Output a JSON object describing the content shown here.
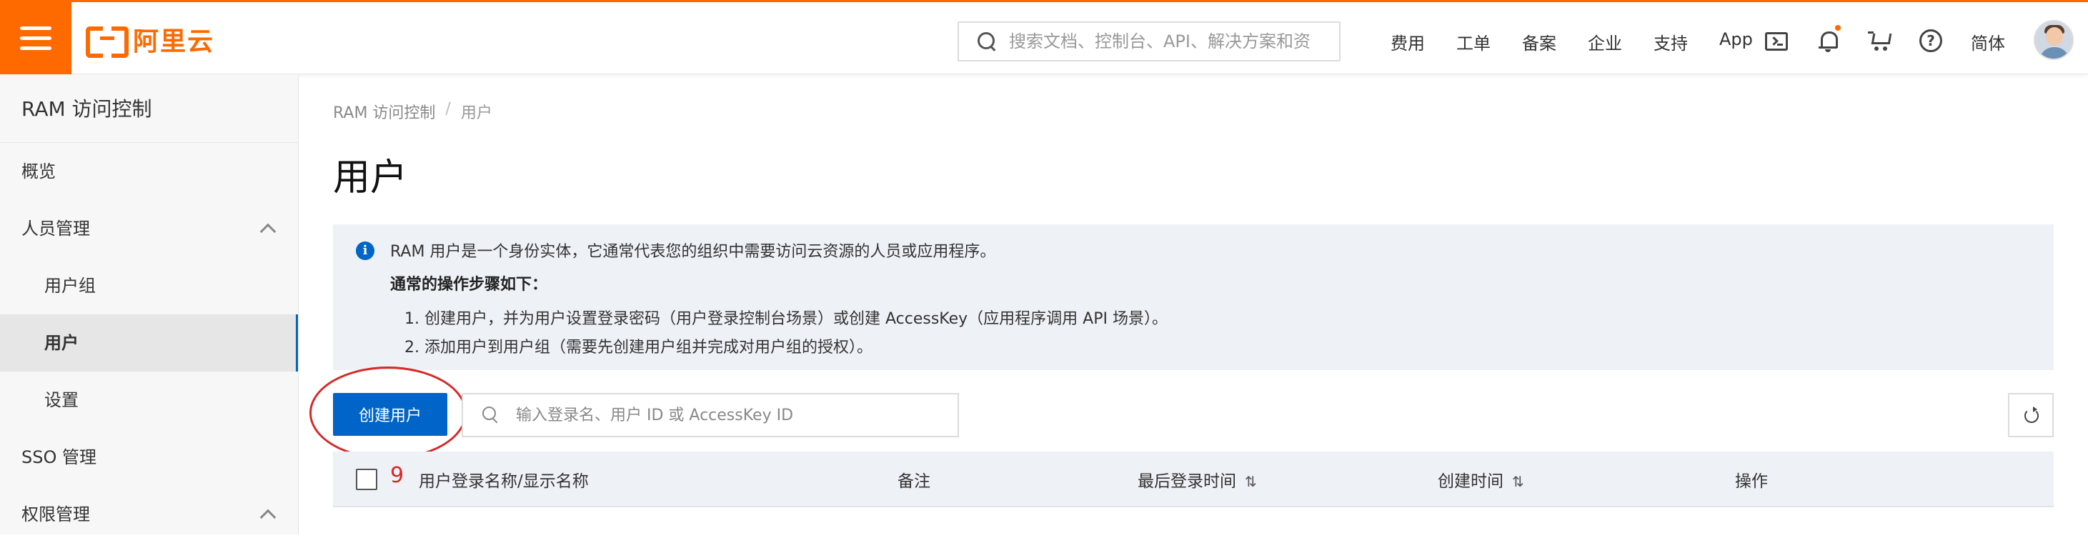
{
  "header": {
    "brand": "阿里云",
    "search_placeholder": "搜索文档、控制台、API、解决方案和资",
    "nav": [
      "费用",
      "工单",
      "备案",
      "企业",
      "支持",
      "App"
    ],
    "help_glyph": "?",
    "language": "简体",
    "accent_color": "#ff6a00"
  },
  "sidebar": {
    "title": "RAM 访问控制",
    "items": [
      {
        "label": "概览"
      },
      {
        "label": "人员管理"
      },
      {
        "label": "用户组"
      },
      {
        "label": "用户"
      },
      {
        "label": "设置"
      },
      {
        "label": "SSO 管理"
      },
      {
        "label": "权限管理"
      }
    ]
  },
  "breadcrumb": {
    "root": "RAM 访问控制",
    "separator": "/",
    "current": "用户"
  },
  "page_title": "用户",
  "info": {
    "icon_glyph": "i",
    "line1": "RAM 用户是一个身份实体，它通常代表您的组织中需要访问云资源的人员或应用程序。",
    "steps_title": "通常的操作步骤如下：",
    "step1": "1. 创建用户，并为用户设置登录密码（用户登录控制台场景）或创建 AccessKey（应用程序调用 API 场景）。",
    "step2": "2. 添加用户到用户组（需要先创建用户组并完成对用户组的授权）。"
  },
  "toolbar": {
    "create_label": "创建用户",
    "search_placeholder": "输入登录名、用户 ID 或 AccessKey ID"
  },
  "table": {
    "count_annotation": "9",
    "columns": [
      "用户登录名称/显示名称",
      "备注",
      "最后登录时间",
      "创建时间",
      "操作"
    ],
    "sort_glyph": "⇅"
  },
  "colors": {
    "primary": "#0064c8",
    "annotation": "#d62828"
  }
}
